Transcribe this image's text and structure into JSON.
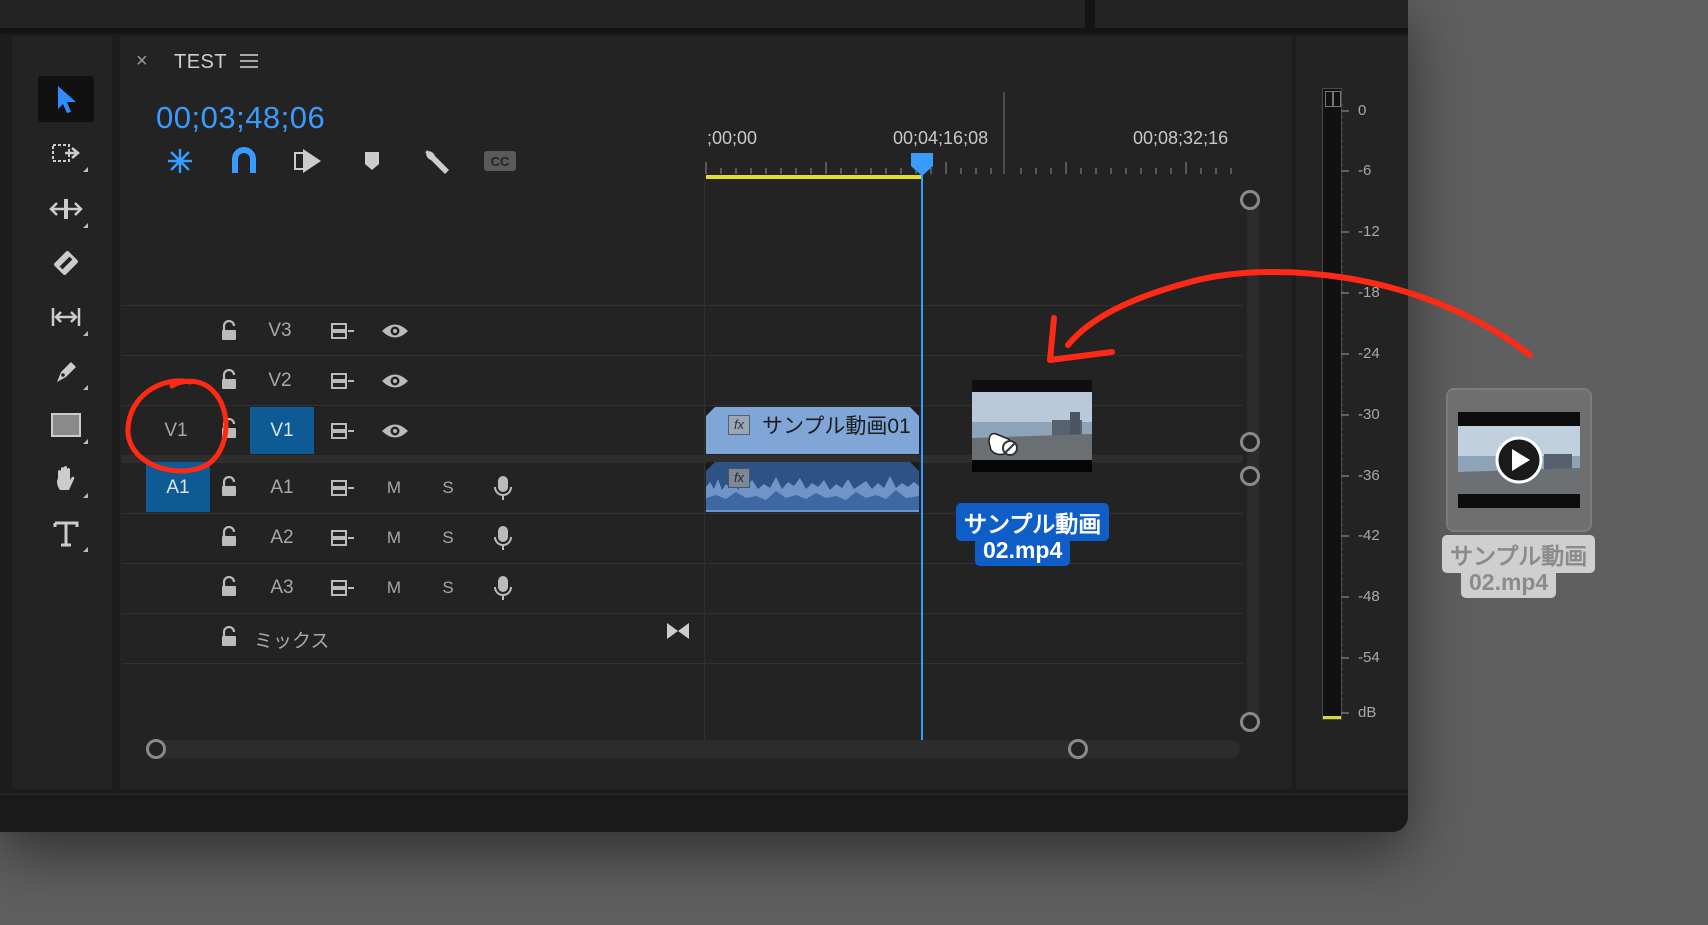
{
  "panel": {
    "close": "×",
    "title": "TEST"
  },
  "timecode": "00;03;48;06",
  "ruler": {
    "labels": [
      ";00;00",
      "00;04;16;08",
      "00;08;32;16"
    ]
  },
  "tracks": {
    "v3": "V3",
    "v2": "V2",
    "v1_source": "V1",
    "v1_target": "V1",
    "a1_source": "A1",
    "a1": "A1",
    "a2": "A2",
    "a3": "A3",
    "mute": "M",
    "solo": "S",
    "mix": "ミックス"
  },
  "clips": {
    "video1": "サンプル動画01",
    "fx": "fx"
  },
  "drag": {
    "line1": "サンプル動画",
    "line2": "02.mp4"
  },
  "file": {
    "line1": "サンプル動画",
    "line2": "02.mp4"
  },
  "meter": {
    "labels": [
      "0",
      "-6",
      "-12",
      "-18",
      "-24",
      "-30",
      "-36",
      "-42",
      "-48",
      "-54",
      "dB"
    ]
  },
  "colors": {
    "accent": "#3a9bff",
    "track_target": "#0e5a95",
    "clip_video": "#7fa6d6",
    "clip_audio": "#2d5283",
    "annotation": "#ff2a16",
    "playhead": "#3a9bff",
    "work_area": "#e5df2a"
  }
}
